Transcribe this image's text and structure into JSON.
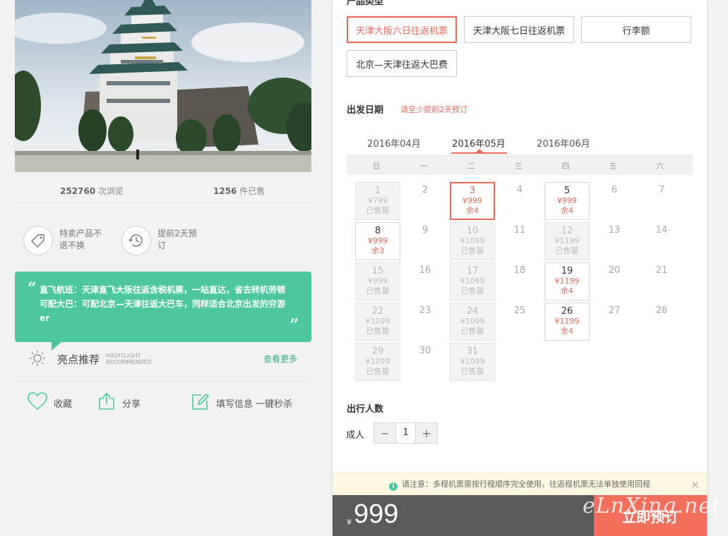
{
  "stats": {
    "views_num": "252760",
    "views_label": " 次浏览",
    "sold_num": "1256",
    "sold_label": " 件已售"
  },
  "features": [
    {
      "line1": "特卖产品不",
      "line2": "退不换"
    },
    {
      "line1": "提前2天预",
      "line2": "订"
    }
  ],
  "quote": {
    "line1": "直飞航班：天津直飞大阪往返含税机票，一站直达，省去转机劳顿",
    "line2": "可配大巴：可配北京—天津往返大巴车，同样适合北京出发的穷游",
    "line3": "er"
  },
  "highlight": {
    "title": "亮点推荐",
    "en1": "HIGHTLIGHT",
    "en2": "RECOMMENDED",
    "more": "查看更多"
  },
  "actions": {
    "favorite": "收藏",
    "share": "分享",
    "fill": "填写信息 一键秒杀"
  },
  "product_type": {
    "title": "产品类型",
    "options": [
      "天津大阪六日往返机票",
      "天津大阪七日往返机票",
      "行李额",
      "北京—天津往返大巴费"
    ]
  },
  "departure": {
    "title": "出发日期",
    "hint": "请至少提前2天预订"
  },
  "months": [
    "2016年04月",
    "2016年05月",
    "2016年06月"
  ],
  "weekdays": [
    "日",
    "一",
    "二",
    "三",
    "四",
    "五",
    "六"
  ],
  "calendar": [
    {
      "day": "1",
      "price": "¥799",
      "status": "已售罄",
      "state": "sold"
    },
    {
      "day": "2",
      "state": "plain"
    },
    {
      "day": "3",
      "price": "¥999",
      "status": "余4",
      "state": "sel"
    },
    {
      "day": "4",
      "state": "plain"
    },
    {
      "day": "5",
      "price": "¥999",
      "status": "余4",
      "state": "avail"
    },
    {
      "day": "6",
      "state": "plain"
    },
    {
      "day": "7",
      "state": "plain"
    },
    {
      "day": "8",
      "price": "¥999",
      "status": "余3",
      "state": "avail"
    },
    {
      "day": "9",
      "state": "plain"
    },
    {
      "day": "10",
      "price": "¥1099",
      "status": "已售罄",
      "state": "sold"
    },
    {
      "day": "11",
      "state": "plain"
    },
    {
      "day": "12",
      "price": "¥1199",
      "status": "已售罄",
      "state": "sold"
    },
    {
      "day": "13",
      "state": "plain"
    },
    {
      "day": "14",
      "state": "plain"
    },
    {
      "day": "15",
      "price": "¥999",
      "status": "已售罄",
      "state": "sold"
    },
    {
      "day": "16",
      "state": "plain"
    },
    {
      "day": "17",
      "price": "¥1099",
      "status": "已售罄",
      "state": "sold"
    },
    {
      "day": "18",
      "state": "plain"
    },
    {
      "day": "19",
      "price": "¥1199",
      "status": "余4",
      "state": "avail"
    },
    {
      "day": "20",
      "state": "plain"
    },
    {
      "day": "21",
      "state": "plain"
    },
    {
      "day": "22",
      "price": "¥1099",
      "status": "已售罄",
      "state": "sold"
    },
    {
      "day": "23",
      "state": "plain"
    },
    {
      "day": "24",
      "price": "¥1099",
      "status": "已售罄",
      "state": "sold"
    },
    {
      "day": "25",
      "state": "plain"
    },
    {
      "day": "26",
      "price": "¥1199",
      "status": "余4",
      "state": "avail"
    },
    {
      "day": "27",
      "state": "plain"
    },
    {
      "day": "28",
      "state": "plain"
    },
    {
      "day": "29",
      "price": "¥1099",
      "status": "已售罄",
      "state": "sold"
    },
    {
      "day": "30",
      "state": "plain"
    },
    {
      "day": "31",
      "price": "¥1099",
      "status": "已售罄",
      "state": "sold"
    }
  ],
  "travelers": {
    "title": "出行人数",
    "adult_label": "成人",
    "count": "1",
    "minus": "−",
    "plus": "+"
  },
  "notice": {
    "icon": "i",
    "text": "请注意：多程机票需按行程顺序完全使用，往返程机票无法单独使用回程",
    "close": "×"
  },
  "bottom": {
    "currency": "¥",
    "price": "999",
    "book": "立即预订",
    "watermark": "eLnXing.net"
  },
  "colors": {
    "accent": "#e9685a",
    "green": "#4dc7a0",
    "book": "#f26f5e",
    "bar": "#5a5a5a"
  }
}
